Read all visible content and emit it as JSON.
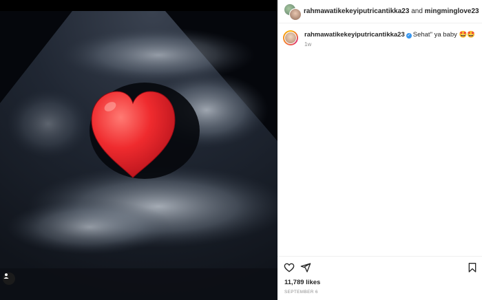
{
  "header": {
    "username1": "rahmawatikekeyiputricantikka23",
    "conjunction": "and",
    "username2": "mingminglove23"
  },
  "caption": {
    "username": "rahmawatikekeyiputricantikka23",
    "text": "Sehat\" ya baby 🤩🤩",
    "time": "1w"
  },
  "post": {
    "likes": "11,789 likes",
    "date": "SEPTEMBER 6"
  },
  "icons": {
    "like": "heart-outline-icon",
    "share": "paper-plane-icon",
    "save": "bookmark-icon",
    "user_tag": "user-icon",
    "overlay": "red-heart-emoji"
  },
  "colors": {
    "verified": "#3897f0",
    "heart": "#e0242c"
  }
}
